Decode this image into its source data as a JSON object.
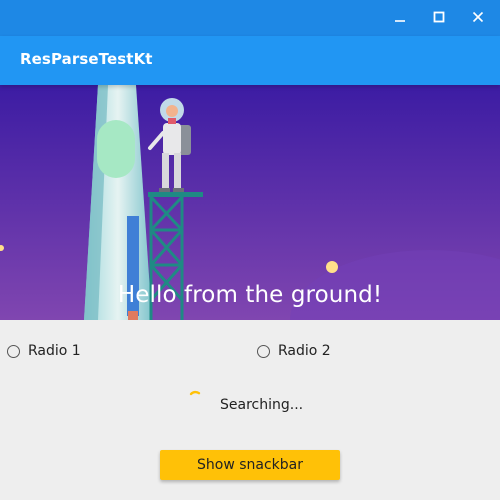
{
  "window": {
    "controls": [
      {
        "name": "minimize",
        "icon": "minimize-icon"
      },
      {
        "name": "maximize",
        "icon": "maximize-icon"
      },
      {
        "name": "close",
        "icon": "close-icon"
      }
    ],
    "bar_color": "#1e88e5"
  },
  "app_bar": {
    "title": "ResParseTestKt",
    "color": "#2196f3"
  },
  "hero": {
    "illustration": "astronaut-on-tower-illustration",
    "greeting": "Hello from the ground!",
    "gradient_top": "#3c1ca3",
    "gradient_bottom": "#8046b0"
  },
  "radios": [
    {
      "label": "Radio 1",
      "selected": false
    },
    {
      "label": "Radio 2",
      "selected": false
    }
  ],
  "status": {
    "icon": "loading-spinner-icon",
    "text": "Searching..."
  },
  "action": {
    "button_label": "Show snackbar",
    "color": "#ffc107"
  }
}
